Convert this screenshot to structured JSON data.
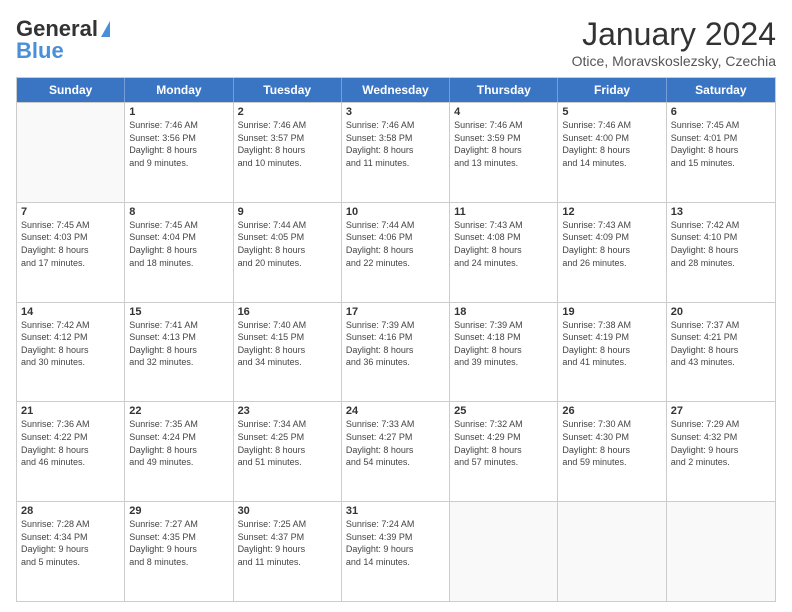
{
  "logo": {
    "part1": "General",
    "part2": "Blue"
  },
  "title": "January 2024",
  "subtitle": "Otice, Moravskoslezsky, Czechia",
  "weekdays": [
    "Sunday",
    "Monday",
    "Tuesday",
    "Wednesday",
    "Thursday",
    "Friday",
    "Saturday"
  ],
  "rows": [
    [
      {
        "day": "",
        "lines": []
      },
      {
        "day": "1",
        "lines": [
          "Sunrise: 7:46 AM",
          "Sunset: 3:56 PM",
          "Daylight: 8 hours",
          "and 9 minutes."
        ]
      },
      {
        "day": "2",
        "lines": [
          "Sunrise: 7:46 AM",
          "Sunset: 3:57 PM",
          "Daylight: 8 hours",
          "and 10 minutes."
        ]
      },
      {
        "day": "3",
        "lines": [
          "Sunrise: 7:46 AM",
          "Sunset: 3:58 PM",
          "Daylight: 8 hours",
          "and 11 minutes."
        ]
      },
      {
        "day": "4",
        "lines": [
          "Sunrise: 7:46 AM",
          "Sunset: 3:59 PM",
          "Daylight: 8 hours",
          "and 13 minutes."
        ]
      },
      {
        "day": "5",
        "lines": [
          "Sunrise: 7:46 AM",
          "Sunset: 4:00 PM",
          "Daylight: 8 hours",
          "and 14 minutes."
        ]
      },
      {
        "day": "6",
        "lines": [
          "Sunrise: 7:45 AM",
          "Sunset: 4:01 PM",
          "Daylight: 8 hours",
          "and 15 minutes."
        ]
      }
    ],
    [
      {
        "day": "7",
        "lines": [
          "Sunrise: 7:45 AM",
          "Sunset: 4:03 PM",
          "Daylight: 8 hours",
          "and 17 minutes."
        ]
      },
      {
        "day": "8",
        "lines": [
          "Sunrise: 7:45 AM",
          "Sunset: 4:04 PM",
          "Daylight: 8 hours",
          "and 18 minutes."
        ]
      },
      {
        "day": "9",
        "lines": [
          "Sunrise: 7:44 AM",
          "Sunset: 4:05 PM",
          "Daylight: 8 hours",
          "and 20 minutes."
        ]
      },
      {
        "day": "10",
        "lines": [
          "Sunrise: 7:44 AM",
          "Sunset: 4:06 PM",
          "Daylight: 8 hours",
          "and 22 minutes."
        ]
      },
      {
        "day": "11",
        "lines": [
          "Sunrise: 7:43 AM",
          "Sunset: 4:08 PM",
          "Daylight: 8 hours",
          "and 24 minutes."
        ]
      },
      {
        "day": "12",
        "lines": [
          "Sunrise: 7:43 AM",
          "Sunset: 4:09 PM",
          "Daylight: 8 hours",
          "and 26 minutes."
        ]
      },
      {
        "day": "13",
        "lines": [
          "Sunrise: 7:42 AM",
          "Sunset: 4:10 PM",
          "Daylight: 8 hours",
          "and 28 minutes."
        ]
      }
    ],
    [
      {
        "day": "14",
        "lines": [
          "Sunrise: 7:42 AM",
          "Sunset: 4:12 PM",
          "Daylight: 8 hours",
          "and 30 minutes."
        ]
      },
      {
        "day": "15",
        "lines": [
          "Sunrise: 7:41 AM",
          "Sunset: 4:13 PM",
          "Daylight: 8 hours",
          "and 32 minutes."
        ]
      },
      {
        "day": "16",
        "lines": [
          "Sunrise: 7:40 AM",
          "Sunset: 4:15 PM",
          "Daylight: 8 hours",
          "and 34 minutes."
        ]
      },
      {
        "day": "17",
        "lines": [
          "Sunrise: 7:39 AM",
          "Sunset: 4:16 PM",
          "Daylight: 8 hours",
          "and 36 minutes."
        ]
      },
      {
        "day": "18",
        "lines": [
          "Sunrise: 7:39 AM",
          "Sunset: 4:18 PM",
          "Daylight: 8 hours",
          "and 39 minutes."
        ]
      },
      {
        "day": "19",
        "lines": [
          "Sunrise: 7:38 AM",
          "Sunset: 4:19 PM",
          "Daylight: 8 hours",
          "and 41 minutes."
        ]
      },
      {
        "day": "20",
        "lines": [
          "Sunrise: 7:37 AM",
          "Sunset: 4:21 PM",
          "Daylight: 8 hours",
          "and 43 minutes."
        ]
      }
    ],
    [
      {
        "day": "21",
        "lines": [
          "Sunrise: 7:36 AM",
          "Sunset: 4:22 PM",
          "Daylight: 8 hours",
          "and 46 minutes."
        ]
      },
      {
        "day": "22",
        "lines": [
          "Sunrise: 7:35 AM",
          "Sunset: 4:24 PM",
          "Daylight: 8 hours",
          "and 49 minutes."
        ]
      },
      {
        "day": "23",
        "lines": [
          "Sunrise: 7:34 AM",
          "Sunset: 4:25 PM",
          "Daylight: 8 hours",
          "and 51 minutes."
        ]
      },
      {
        "day": "24",
        "lines": [
          "Sunrise: 7:33 AM",
          "Sunset: 4:27 PM",
          "Daylight: 8 hours",
          "and 54 minutes."
        ]
      },
      {
        "day": "25",
        "lines": [
          "Sunrise: 7:32 AM",
          "Sunset: 4:29 PM",
          "Daylight: 8 hours",
          "and 57 minutes."
        ]
      },
      {
        "day": "26",
        "lines": [
          "Sunrise: 7:30 AM",
          "Sunset: 4:30 PM",
          "Daylight: 8 hours",
          "and 59 minutes."
        ]
      },
      {
        "day": "27",
        "lines": [
          "Sunrise: 7:29 AM",
          "Sunset: 4:32 PM",
          "Daylight: 9 hours",
          "and 2 minutes."
        ]
      }
    ],
    [
      {
        "day": "28",
        "lines": [
          "Sunrise: 7:28 AM",
          "Sunset: 4:34 PM",
          "Daylight: 9 hours",
          "and 5 minutes."
        ]
      },
      {
        "day": "29",
        "lines": [
          "Sunrise: 7:27 AM",
          "Sunset: 4:35 PM",
          "Daylight: 9 hours",
          "and 8 minutes."
        ]
      },
      {
        "day": "30",
        "lines": [
          "Sunrise: 7:25 AM",
          "Sunset: 4:37 PM",
          "Daylight: 9 hours",
          "and 11 minutes."
        ]
      },
      {
        "day": "31",
        "lines": [
          "Sunrise: 7:24 AM",
          "Sunset: 4:39 PM",
          "Daylight: 9 hours",
          "and 14 minutes."
        ]
      },
      {
        "day": "",
        "lines": []
      },
      {
        "day": "",
        "lines": []
      },
      {
        "day": "",
        "lines": []
      }
    ]
  ]
}
